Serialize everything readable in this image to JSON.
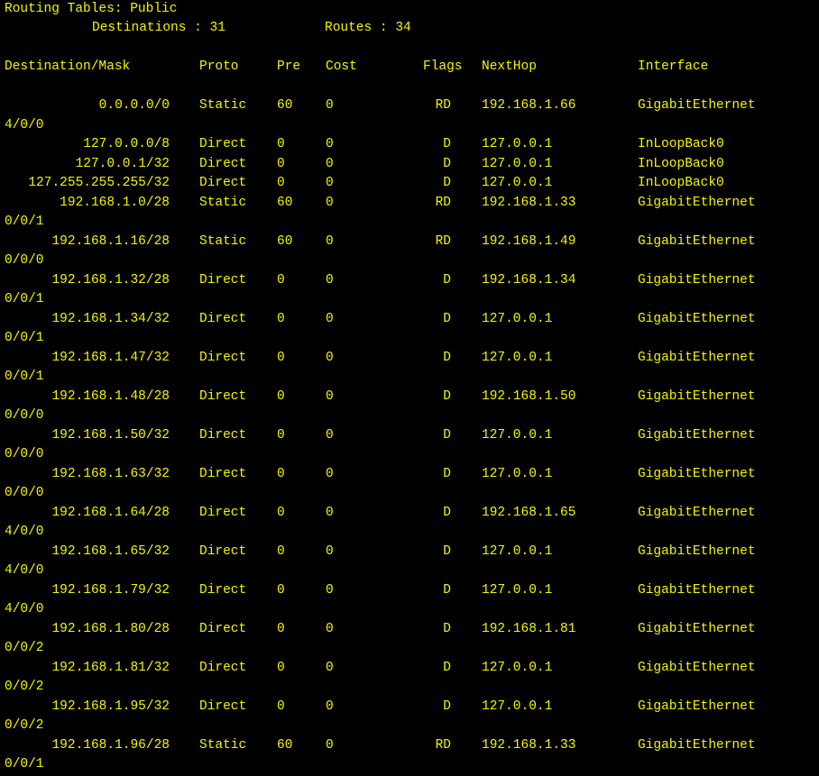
{
  "header": {
    "title": "Routing Tables: Public",
    "destinations_label": "Destinations : 31",
    "routes_label": "Routes : 34"
  },
  "columns": {
    "destination": "Destination/Mask",
    "proto": "Proto",
    "pre": "Pre",
    "cost": "Cost",
    "flags": "Flags",
    "nexthop": "NextHop",
    "interface": "Interface"
  },
  "routes": [
    {
      "dest": "0.0.0.0/0",
      "proto": "Static",
      "pre": "60",
      "cost": "0",
      "flags": "RD",
      "nexthop": "192.168.1.66",
      "iface": "GigabitEthernet",
      "iface_cont": "4/0/0"
    },
    {
      "dest": "127.0.0.0/8",
      "proto": "Direct",
      "pre": "0",
      "cost": "0",
      "flags": "D",
      "nexthop": "127.0.0.1",
      "iface": "InLoopBack0",
      "iface_cont": ""
    },
    {
      "dest": "127.0.0.1/32",
      "proto": "Direct",
      "pre": "0",
      "cost": "0",
      "flags": "D",
      "nexthop": "127.0.0.1",
      "iface": "InLoopBack0",
      "iface_cont": ""
    },
    {
      "dest": "127.255.255.255/32",
      "proto": "Direct",
      "pre": "0",
      "cost": "0",
      "flags": "D",
      "nexthop": "127.0.0.1",
      "iface": "InLoopBack0",
      "iface_cont": ""
    },
    {
      "dest": "192.168.1.0/28",
      "proto": "Static",
      "pre": "60",
      "cost": "0",
      "flags": "RD",
      "nexthop": "192.168.1.33",
      "iface": "GigabitEthernet",
      "iface_cont": "0/0/1"
    },
    {
      "dest": "192.168.1.16/28",
      "proto": "Static",
      "pre": "60",
      "cost": "0",
      "flags": "RD",
      "nexthop": "192.168.1.49",
      "iface": "GigabitEthernet",
      "iface_cont": "0/0/0"
    },
    {
      "dest": "192.168.1.32/28",
      "proto": "Direct",
      "pre": "0",
      "cost": "0",
      "flags": "D",
      "nexthop": "192.168.1.34",
      "iface": "GigabitEthernet",
      "iface_cont": "0/0/1"
    },
    {
      "dest": "192.168.1.34/32",
      "proto": "Direct",
      "pre": "0",
      "cost": "0",
      "flags": "D",
      "nexthop": "127.0.0.1",
      "iface": "GigabitEthernet",
      "iface_cont": "0/0/1"
    },
    {
      "dest": "192.168.1.47/32",
      "proto": "Direct",
      "pre": "0",
      "cost": "0",
      "flags": "D",
      "nexthop": "127.0.0.1",
      "iface": "GigabitEthernet",
      "iface_cont": "0/0/1"
    },
    {
      "dest": "192.168.1.48/28",
      "proto": "Direct",
      "pre": "0",
      "cost": "0",
      "flags": "D",
      "nexthop": "192.168.1.50",
      "iface": "GigabitEthernet",
      "iface_cont": "0/0/0"
    },
    {
      "dest": "192.168.1.50/32",
      "proto": "Direct",
      "pre": "0",
      "cost": "0",
      "flags": "D",
      "nexthop": "127.0.0.1",
      "iface": "GigabitEthernet",
      "iface_cont": "0/0/0"
    },
    {
      "dest": "192.168.1.63/32",
      "proto": "Direct",
      "pre": "0",
      "cost": "0",
      "flags": "D",
      "nexthop": "127.0.0.1",
      "iface": "GigabitEthernet",
      "iface_cont": "0/0/0"
    },
    {
      "dest": "192.168.1.64/28",
      "proto": "Direct",
      "pre": "0",
      "cost": "0",
      "flags": "D",
      "nexthop": "192.168.1.65",
      "iface": "GigabitEthernet",
      "iface_cont": "4/0/0"
    },
    {
      "dest": "192.168.1.65/32",
      "proto": "Direct",
      "pre": "0",
      "cost": "0",
      "flags": "D",
      "nexthop": "127.0.0.1",
      "iface": "GigabitEthernet",
      "iface_cont": "4/0/0"
    },
    {
      "dest": "192.168.1.79/32",
      "proto": "Direct",
      "pre": "0",
      "cost": "0",
      "flags": "D",
      "nexthop": "127.0.0.1",
      "iface": "GigabitEthernet",
      "iface_cont": "4/0/0"
    },
    {
      "dest": "192.168.1.80/28",
      "proto": "Direct",
      "pre": "0",
      "cost": "0",
      "flags": "D",
      "nexthop": "192.168.1.81",
      "iface": "GigabitEthernet",
      "iface_cont": "0/0/2"
    },
    {
      "dest": "192.168.1.81/32",
      "proto": "Direct",
      "pre": "0",
      "cost": "0",
      "flags": "D",
      "nexthop": "127.0.0.1",
      "iface": "GigabitEthernet",
      "iface_cont": "0/0/2"
    },
    {
      "dest": "192.168.1.95/32",
      "proto": "Direct",
      "pre": "0",
      "cost": "0",
      "flags": "D",
      "nexthop": "127.0.0.1",
      "iface": "GigabitEthernet",
      "iface_cont": "0/0/2"
    },
    {
      "dest": "192.168.1.96/28",
      "proto": "Static",
      "pre": "60",
      "cost": "0",
      "flags": "RD",
      "nexthop": "192.168.1.33",
      "iface": "GigabitEthernet",
      "iface_cont": "0/0/1"
    }
  ],
  "colors": {
    "background": "#000000",
    "text": "#f5f500"
  }
}
